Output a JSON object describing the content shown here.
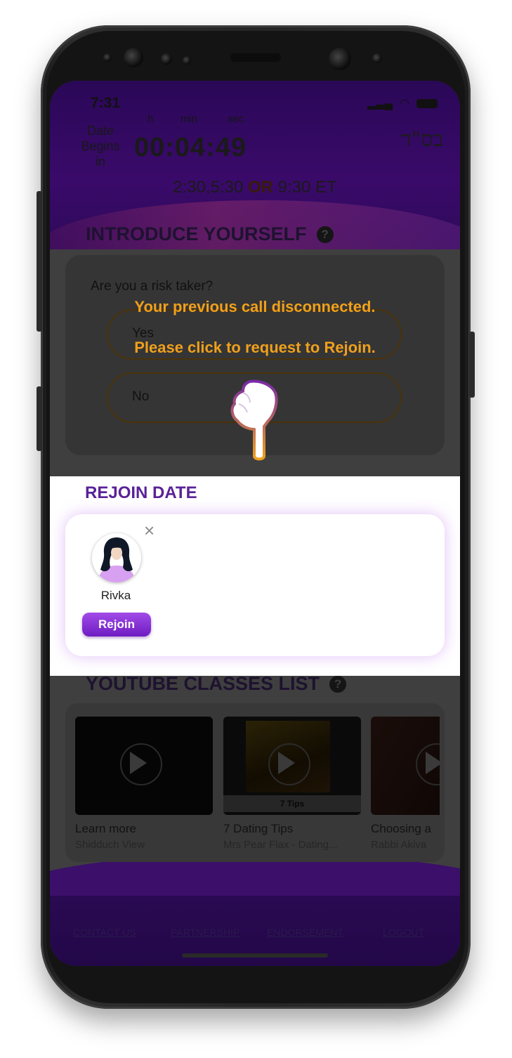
{
  "status_bar": {
    "time": "7:31"
  },
  "header": {
    "date_begins_label": [
      "Date",
      "Begins",
      "in"
    ],
    "units": {
      "h": "h",
      "min": "min",
      "sec": "sec"
    },
    "countdown": "00:04:49",
    "hebrew_mark": "בס\"ד",
    "times_prefix": "2:30,5:30",
    "times_or": "OR",
    "times_suffix": "9:30 ET"
  },
  "introduce": {
    "title": "INTRODUCE YOURSELF",
    "help_icon": "?",
    "question": "Are you a risk taker?",
    "options": [
      "Yes",
      "No"
    ]
  },
  "overlay_message": {
    "line1": "Your previous call disconnected.",
    "line2": "Please click to request to Rejoin."
  },
  "rejoin": {
    "title": "REJOIN DATE",
    "close_icon": "×",
    "name": "Rivka",
    "button_label": "Rejoin"
  },
  "youtube": {
    "title": "YOUTUBE CLASSES LIST",
    "help_icon": "?",
    "videos": [
      {
        "title": "Learn more",
        "subtitle": "Shidduch View"
      },
      {
        "title": "7 Dating Tips",
        "subtitle": "Mrs Pear Flax - Dating...",
        "thumb_caption": "7 Tips"
      },
      {
        "title": "Choosing a",
        "subtitle": "Rabbi Akiva"
      }
    ]
  },
  "footer": {
    "links": [
      "CONTACT US",
      "PARTNERSHIP",
      "ENDORSEMENT",
      "LOGOUT"
    ]
  },
  "colors": {
    "brand_purple": "#5a2298",
    "accent_orange": "#f0a01c",
    "rejoin_button": "#8a35d8"
  }
}
